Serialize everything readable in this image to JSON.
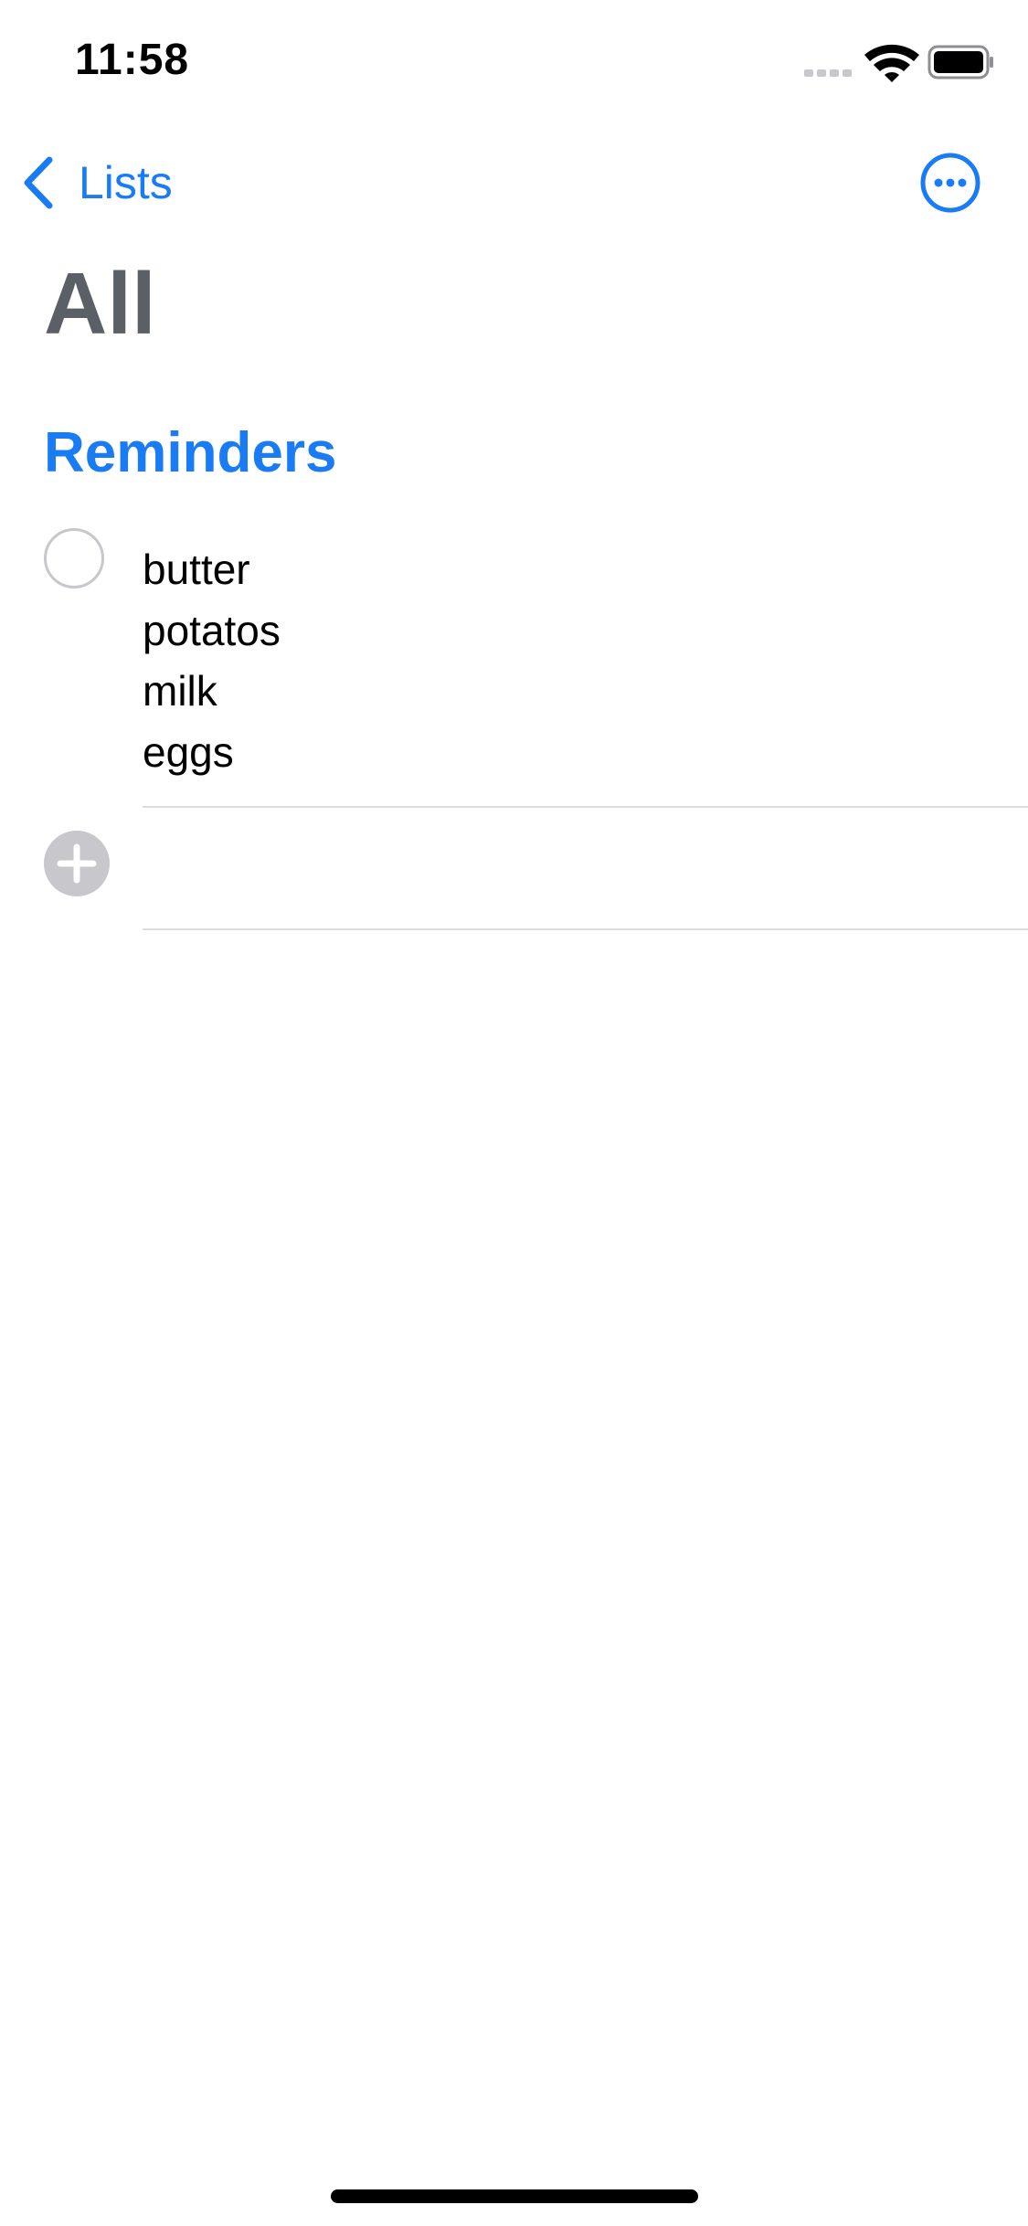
{
  "status_bar": {
    "time": "11:58",
    "icons": [
      "cellular-signal-icon",
      "wifi-icon",
      "battery-icon"
    ]
  },
  "nav": {
    "back_label": "Lists",
    "back_icon": "chevron-left-icon",
    "more_icon": "ellipsis-circle-icon"
  },
  "title": "All",
  "section": {
    "title": "Reminders"
  },
  "reminders": [
    {
      "lines": [
        "butter",
        "potatos",
        "milk",
        "eggs"
      ],
      "completed": false
    }
  ],
  "add_row": {
    "icon": "plus-circle-icon"
  },
  "colors": {
    "accent": "#1a7cf5",
    "title": "#5b5f66",
    "circle_border": "#c7c7cc",
    "add_icon": "#c7c7cc",
    "separator": "#dcdcdf"
  }
}
